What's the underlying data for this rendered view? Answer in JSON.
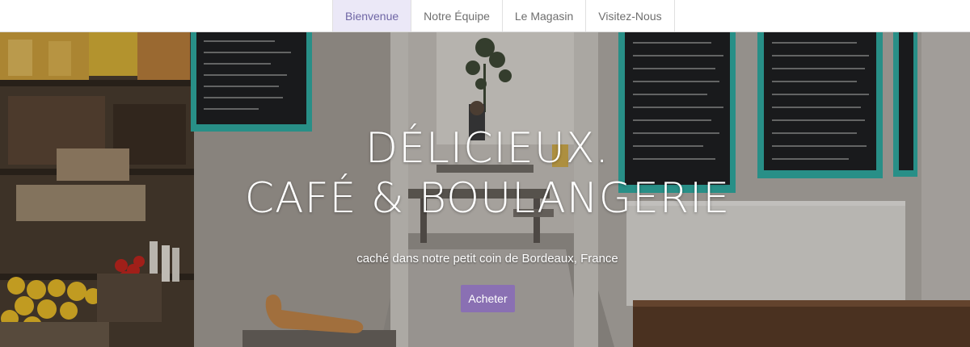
{
  "nav": {
    "items": [
      {
        "label": "Bienvenue",
        "active": true
      },
      {
        "label": "Notre Équipe",
        "active": false
      },
      {
        "label": "Le Magasin",
        "active": false
      },
      {
        "label": "Visitez-Nous",
        "active": false
      }
    ]
  },
  "hero": {
    "title_line1": "DÉLICIEUX.",
    "title_line2": "CAFÉ & BOULANGERIE",
    "subtitle": "caché dans notre petit coin de Bordeaux, France",
    "button_label": "Acheter"
  },
  "colors": {
    "nav_active_bg": "#ebe8f7",
    "nav_active_text": "#6f66a5",
    "button_bg": "#8a70b3",
    "chalkboard_frame": "#2fb3a8"
  }
}
